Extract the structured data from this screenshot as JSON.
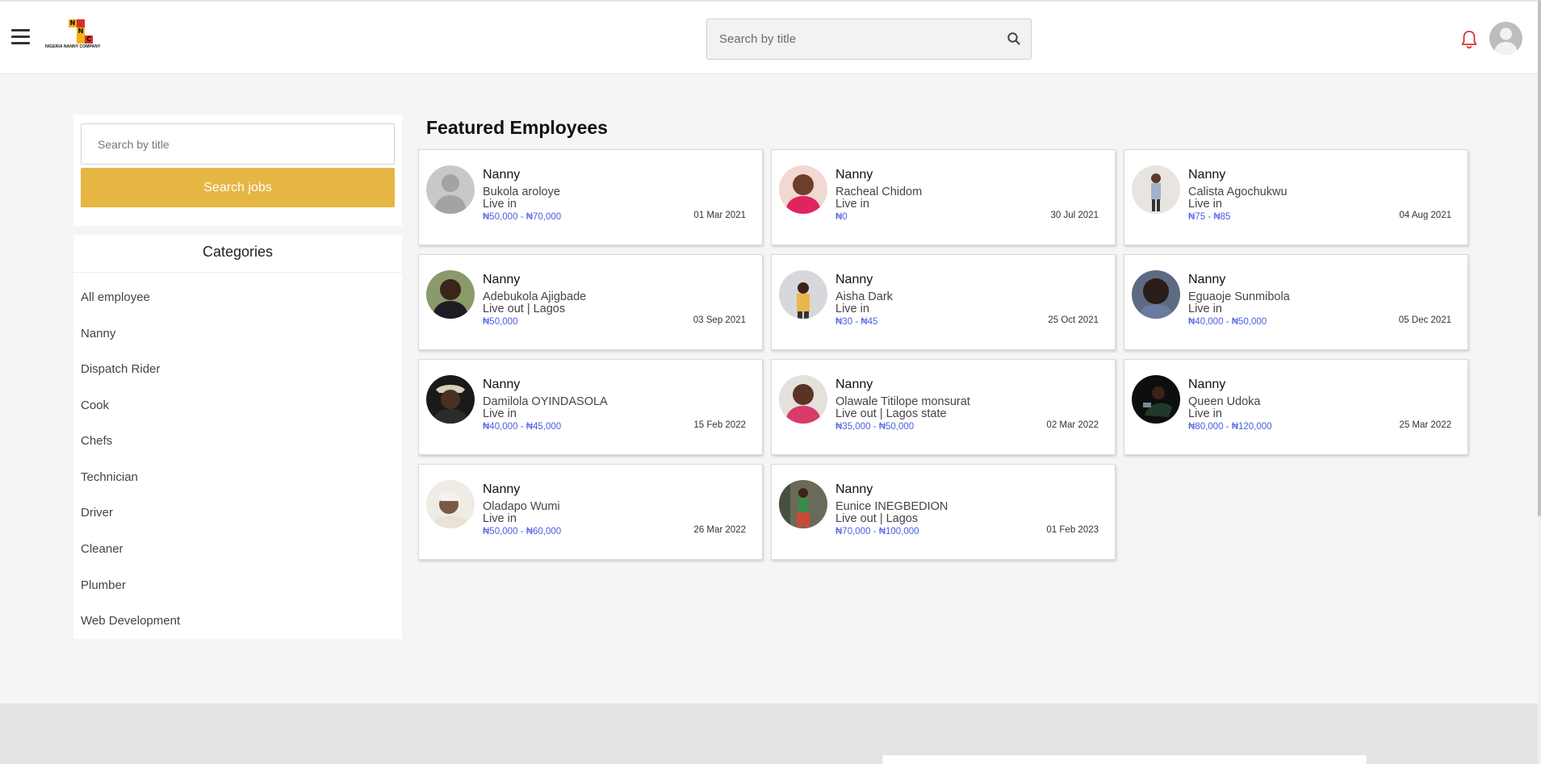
{
  "header": {
    "logo_letters": [
      "N",
      "N",
      "C"
    ],
    "logo_text": "NIGERIA NANNY COMPANY",
    "search_placeholder": "Search by title"
  },
  "sidebar": {
    "search_placeholder": "Search by title",
    "search_button": "Search jobs",
    "categories_title": "Categories",
    "categories": [
      "All employee",
      "Nanny",
      "Dispatch Rider",
      "Cook",
      "Chefs",
      "Technician",
      "Driver",
      "Cleaner",
      "Plumber",
      "Web Development"
    ]
  },
  "main": {
    "title": "Featured Employees",
    "employees": [
      {
        "role": "Nanny",
        "name": "Bukola aroloye",
        "type": "Live in",
        "salary": "₦50,000 - ₦70,000",
        "date": "01 Mar 2021",
        "photo": "placeholder"
      },
      {
        "role": "Nanny",
        "name": "Racheal Chidom",
        "type": "Live in",
        "salary": "₦0",
        "date": "30 Jul 2021",
        "photo": "photo"
      },
      {
        "role": "Nanny",
        "name": "Calista Agochukwu",
        "type": "Live in",
        "salary": "₦75 - ₦85",
        "date": "04 Aug 2021",
        "photo": "photo"
      },
      {
        "role": "Nanny",
        "name": "Adebukola Ajigbade",
        "type": "Live out | Lagos",
        "salary": "₦50,000",
        "date": "03 Sep 2021",
        "photo": "photo"
      },
      {
        "role": "Nanny",
        "name": "Aisha Dark",
        "type": "Live in",
        "salary": "₦30 - ₦45",
        "date": "25 Oct 2021",
        "photo": "photo"
      },
      {
        "role": "Nanny",
        "name": "Eguaoje Sunmibola",
        "type": "Live in",
        "salary": "₦40,000 - ₦50,000",
        "date": "05 Dec 2021",
        "photo": "photo"
      },
      {
        "role": "Nanny",
        "name": "Damilola OYINDASOLA",
        "type": "Live in",
        "salary": "₦40,000 - ₦45,000",
        "date": "15 Feb 2022",
        "photo": "photo"
      },
      {
        "role": "Nanny",
        "name": "Olawale Titilope monsurat",
        "type": "Live out | Lagos state",
        "salary": "₦35,000 - ₦50,000",
        "date": "02 Mar 2022",
        "photo": "photo"
      },
      {
        "role": "Nanny",
        "name": "Queen Udoka",
        "type": "Live in",
        "salary": "₦80,000 - ₦120,000",
        "date": "25 Mar 2022",
        "photo": "photo"
      },
      {
        "role": "Nanny",
        "name": "Oladapo Wumi",
        "type": "Live in",
        "salary": "₦50,000 - ₦60,000",
        "date": "26 Mar 2022",
        "photo": "photo"
      },
      {
        "role": "Nanny",
        "name": "Eunice INEGBEDION",
        "type": "Live out | Lagos",
        "salary": "₦70,000 - ₦100,000",
        "date": "01 Feb 2023",
        "photo": "photo"
      }
    ]
  },
  "colors": {
    "accent": "#e6b644",
    "salary": "#4a5de0",
    "bell": "#d9343a"
  }
}
